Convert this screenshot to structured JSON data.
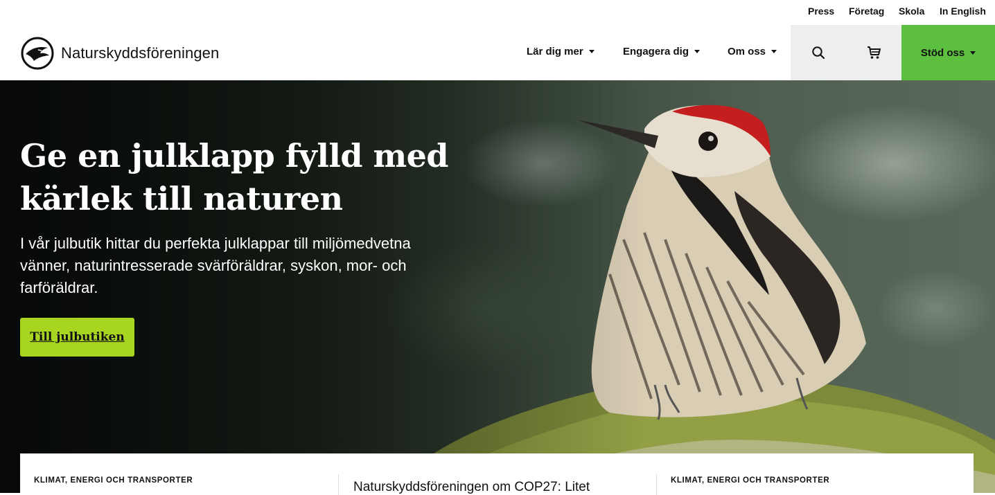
{
  "utility_nav": [
    "Press",
    "Företag",
    "Skola",
    "In English"
  ],
  "brand": {
    "name": "Naturskyddsföreningen",
    "logo_icon": "bird-circle-logo"
  },
  "main_nav": [
    {
      "label": "Lär dig mer"
    },
    {
      "label": "Engagera dig"
    },
    {
      "label": "Om oss"
    }
  ],
  "actions": {
    "search_icon": "search-icon",
    "cart_icon": "cart-icon",
    "support_label": "Stöd oss"
  },
  "colors": {
    "support_green": "#5cbf3f",
    "cta_lime": "#a8d520"
  },
  "hero": {
    "title": "Ge en julklapp fylld med kärlek till naturen",
    "text": "I vår julbutik hittar du perfekta julklappar till miljömedvetna vänner, naturintresserade svärföräldrar, syskon, mor- och farföräldrar.",
    "cta": "Till julbutiken"
  },
  "cards": [
    {
      "category": "KLIMAT, ENERGI OCH TRANSPORTER"
    },
    {
      "headline": "Naturskyddsföreningen om COP27: Litet"
    },
    {
      "category": "KLIMAT, ENERGI OCH TRANSPORTER"
    }
  ]
}
